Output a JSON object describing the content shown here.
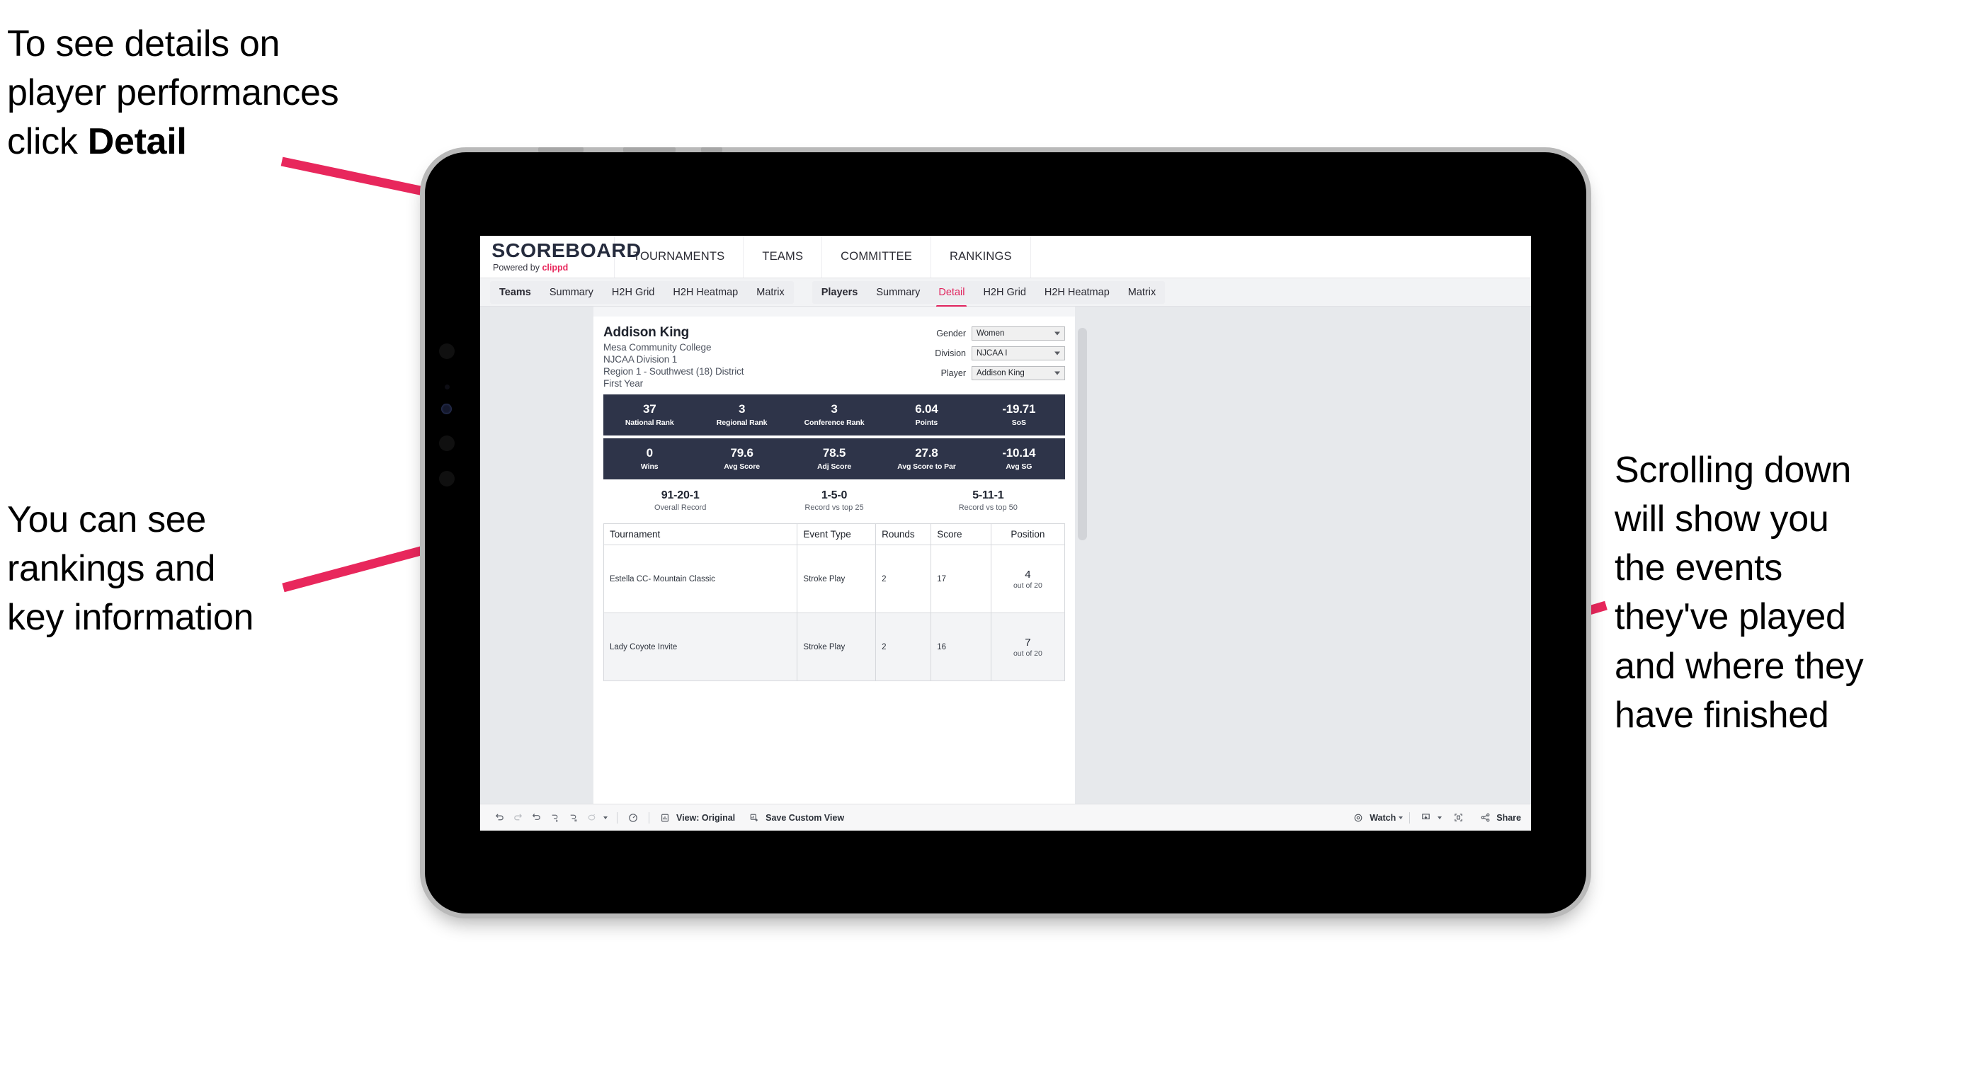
{
  "annotations": {
    "top_left": "To see details on\nplayer performances\nclick ",
    "top_left_bold": "Detail",
    "mid_left": "You can see\nrankings and\nkey information",
    "right": "Scrolling down\nwill show you\nthe events\nthey've played\nand where they\nhave finished"
  },
  "accent_color": "#e8275c",
  "navy_color": "#2e3449",
  "app": {
    "logo": {
      "main": "SCOREBOARD",
      "powered": "Powered by ",
      "brand": "clippd"
    },
    "top_nav": [
      "TOURNAMENTS",
      "TEAMS",
      "COMMITTEE",
      "RANKINGS"
    ],
    "tab_groups": [
      {
        "label": "Teams",
        "tabs": [
          "Summary",
          "H2H Grid",
          "H2H Heatmap",
          "Matrix"
        ],
        "active": null
      },
      {
        "label": "Players",
        "tabs": [
          "Summary",
          "Detail",
          "H2H Grid",
          "H2H Heatmap",
          "Matrix"
        ],
        "active": "Detail"
      }
    ]
  },
  "player": {
    "name": "Addison King",
    "school": "Mesa Community College",
    "division": "NJCAA Division 1",
    "region": "Region 1 - Southwest (18) District",
    "year": "First Year"
  },
  "filters": [
    {
      "label": "Gender",
      "value": "Women"
    },
    {
      "label": "Division",
      "value": "NJCAA I"
    },
    {
      "label": "Player",
      "value": "Addison King"
    }
  ],
  "stats_row_1": [
    {
      "value": "37",
      "label": "National Rank"
    },
    {
      "value": "3",
      "label": "Regional Rank"
    },
    {
      "value": "3",
      "label": "Conference Rank"
    },
    {
      "value": "6.04",
      "label": "Points"
    },
    {
      "value": "-19.71",
      "label": "SoS"
    }
  ],
  "stats_row_2": [
    {
      "value": "0",
      "label": "Wins"
    },
    {
      "value": "79.6",
      "label": "Avg Score"
    },
    {
      "value": "78.5",
      "label": "Adj Score"
    },
    {
      "value": "27.8",
      "label": "Avg Score to Par"
    },
    {
      "value": "-10.14",
      "label": "Avg SG"
    }
  ],
  "records": [
    {
      "value": "91-20-1",
      "label": "Overall Record"
    },
    {
      "value": "1-5-0",
      "label": "Record vs top 25"
    },
    {
      "value": "5-11-1",
      "label": "Record vs top 50"
    }
  ],
  "table": {
    "headers": [
      "Tournament",
      "Event Type",
      "Rounds",
      "Score",
      "Position"
    ],
    "rows": [
      {
        "tournament": "Estella CC- Mountain Classic",
        "event_type": "Stroke Play",
        "rounds": "2",
        "score": "17",
        "position": "4",
        "position_of": "out of 20"
      },
      {
        "tournament": "Lady Coyote Invite",
        "event_type": "Stroke Play",
        "rounds": "2",
        "score": "16",
        "position": "7",
        "position_of": "out of 20"
      }
    ]
  },
  "toolbar": {
    "view_label": "View: Original",
    "save_label": "Save Custom View",
    "watch_label": "Watch",
    "share_label": "Share"
  }
}
